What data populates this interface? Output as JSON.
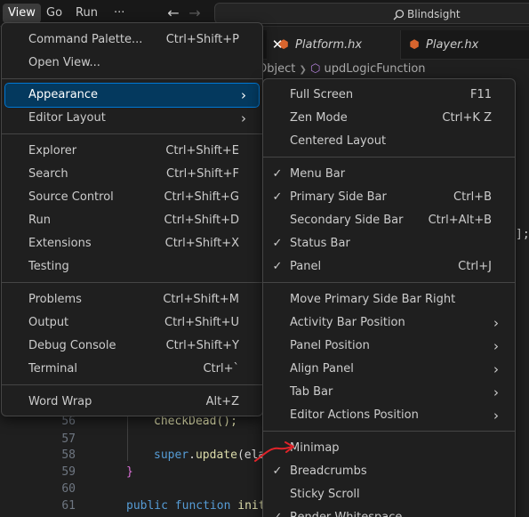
{
  "titlebar": {
    "menus": [
      "View",
      "Go",
      "Run"
    ],
    "more": "···",
    "back": "←",
    "forward": "→",
    "search_text": "Blindsight"
  },
  "editor": {
    "tab_close": "✕",
    "tabs": [
      {
        "icon": "⬢",
        "label": "Platform.hx"
      },
      {
        "icon": "⬢",
        "label": "Player.hx"
      }
    ],
    "breadcrumb": {
      "item1": "Object",
      "sep": "❯",
      "item2": "updLogicFunction"
    },
    "trailing_code": "];",
    "lines": [
      {
        "num": "56",
        "code": "checkDead();"
      },
      {
        "num": "57",
        "code": ""
      },
      {
        "num": "58",
        "code_kw": "super",
        "code_fn": "update",
        "code_rest": "(ela"
      },
      {
        "num": "59",
        "code": "}"
      },
      {
        "num": "60",
        "code": ""
      },
      {
        "num": "61",
        "code_kw1": "public",
        "code_kw2": "function",
        "code_rest": "init"
      }
    ]
  },
  "view_menu": {
    "items": [
      {
        "label": "Command Palette...",
        "key": "Ctrl+Shift+P"
      },
      {
        "label": "Open View...",
        "key": ""
      },
      {
        "label": "Appearance",
        "key": "",
        "arrow": "›"
      },
      {
        "label": "Editor Layout",
        "key": "",
        "arrow": "›"
      },
      {
        "label": "Explorer",
        "key": "Ctrl+Shift+E"
      },
      {
        "label": "Search",
        "key": "Ctrl+Shift+F"
      },
      {
        "label": "Source Control",
        "key": "Ctrl+Shift+G"
      },
      {
        "label": "Run",
        "key": "Ctrl+Shift+D"
      },
      {
        "label": "Extensions",
        "key": "Ctrl+Shift+X"
      },
      {
        "label": "Testing",
        "key": ""
      },
      {
        "label": "Problems",
        "key": "Ctrl+Shift+M"
      },
      {
        "label": "Output",
        "key": "Ctrl+Shift+U"
      },
      {
        "label": "Debug Console",
        "key": "Ctrl+Shift+Y"
      },
      {
        "label": "Terminal",
        "key": "Ctrl+`"
      },
      {
        "label": "Word Wrap",
        "key": "Alt+Z"
      }
    ]
  },
  "appearance_menu": {
    "check": "✓",
    "arrow": "›",
    "items": [
      {
        "label": "Full Screen",
        "key": "F11"
      },
      {
        "label": "Zen Mode",
        "key": "Ctrl+K Z"
      },
      {
        "label": "Centered Layout",
        "key": ""
      },
      {
        "label": "Menu Bar",
        "key": "",
        "checked": true
      },
      {
        "label": "Primary Side Bar",
        "key": "Ctrl+B",
        "checked": true
      },
      {
        "label": "Secondary Side Bar",
        "key": "Ctrl+Alt+B"
      },
      {
        "label": "Status Bar",
        "key": "",
        "checked": true
      },
      {
        "label": "Panel",
        "key": "Ctrl+J",
        "checked": true
      },
      {
        "label": "Move Primary Side Bar Right",
        "key": ""
      },
      {
        "label": "Activity Bar Position",
        "key": ""
      },
      {
        "label": "Panel Position",
        "key": ""
      },
      {
        "label": "Align Panel",
        "key": ""
      },
      {
        "label": "Tab Bar",
        "key": ""
      },
      {
        "label": "Editor Actions Position",
        "key": ""
      },
      {
        "label": "Minimap",
        "key": ""
      },
      {
        "label": "Breadcrumbs",
        "key": "",
        "checked": true
      },
      {
        "label": "Sticky Scroll",
        "key": ""
      },
      {
        "label": "Render Whitespace",
        "key": "",
        "checked": true
      }
    ]
  },
  "colors": {
    "highlight_bg": "#04395e",
    "highlight_border": "#0078d4",
    "annotation": "#e0242a"
  }
}
